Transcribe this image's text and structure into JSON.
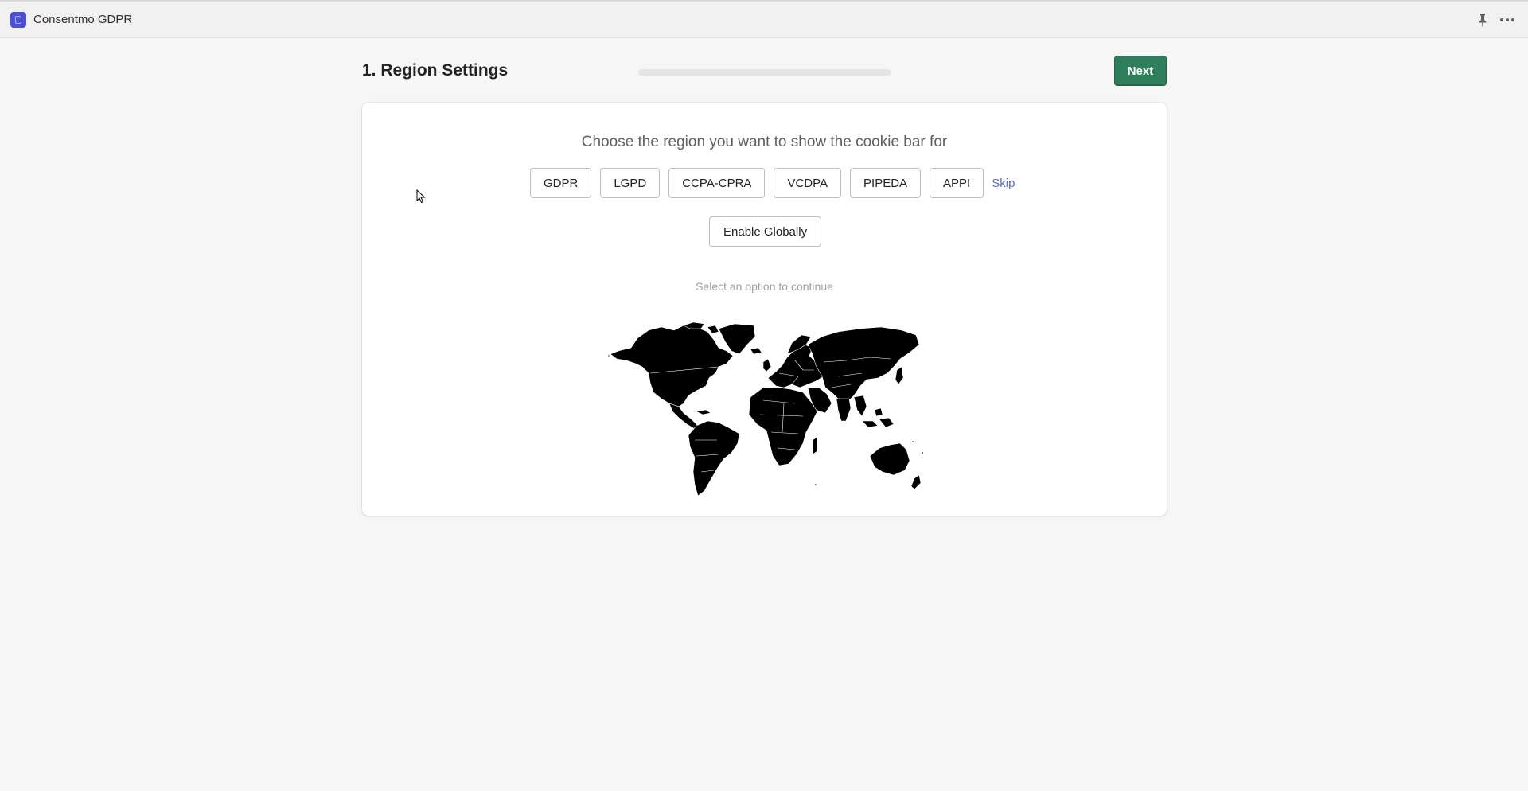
{
  "app": {
    "title": "Consentmo GDPR",
    "icon": "app-logo-icon",
    "brand_color": "#4a4fd6"
  },
  "topbar": {
    "pin_icon": "pin-icon",
    "more_icon": "more-horizontal-icon"
  },
  "header": {
    "title": "1. Region Settings",
    "next_label": "Next",
    "progress": 0
  },
  "card": {
    "heading": "Choose the region you want to show the cookie bar for",
    "regions": [
      "GDPR",
      "LGPD",
      "CCPA-CPRA",
      "VCDPA",
      "PIPEDA",
      "APPI"
    ],
    "skip_label": "Skip",
    "enable_globally_label": "Enable Globally",
    "hint": "Select an option to continue",
    "map": "world-map"
  },
  "colors": {
    "accent": "#2e7d5b",
    "link": "#5c6ac4",
    "page_background": "#f6f6f7"
  }
}
